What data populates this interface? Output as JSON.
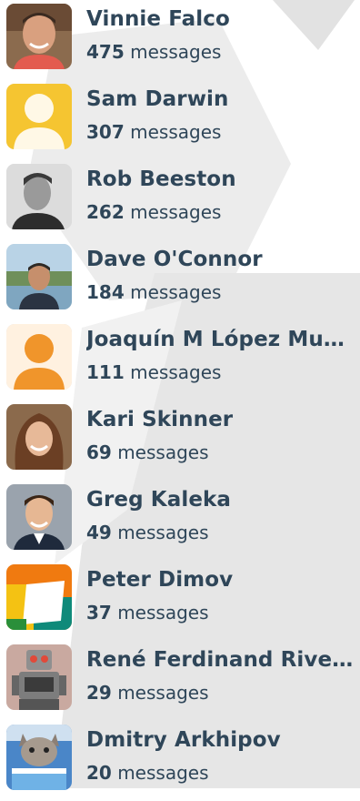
{
  "people": [
    {
      "name": "Vinnie Falco",
      "count": "475",
      "unit": "messages",
      "avatar": "photo-vinnie-icon"
    },
    {
      "name": "Sam Darwin",
      "count": "307",
      "unit": "messages",
      "avatar": "default-user-icon",
      "color": "#f5c531"
    },
    {
      "name": "Rob Beeston",
      "count": "262",
      "unit": "messages",
      "avatar": "photo-rob-icon"
    },
    {
      "name": "Dave O'Connor",
      "count": "184",
      "unit": "messages",
      "avatar": "photo-dave-icon"
    },
    {
      "name": "Joaquín M López Muñoz",
      "count": "111",
      "unit": "messages",
      "avatar": "default-user-icon",
      "color": "#f0952b"
    },
    {
      "name": "Kari Skinner",
      "count": "69",
      "unit": "messages",
      "avatar": "photo-kari-icon"
    },
    {
      "name": "Greg Kaleka",
      "count": "49",
      "unit": "messages",
      "avatar": "photo-greg-icon"
    },
    {
      "name": "Peter Dimov",
      "count": "37",
      "unit": "messages",
      "avatar": "tile-logo-icon"
    },
    {
      "name": "René Ferdinand Rivera Morell",
      "count": "29",
      "unit": "messages",
      "avatar": "robot-icon"
    },
    {
      "name": "Dmitry Arkhipov",
      "count": "20",
      "unit": "messages",
      "avatar": "cat-icon"
    }
  ]
}
